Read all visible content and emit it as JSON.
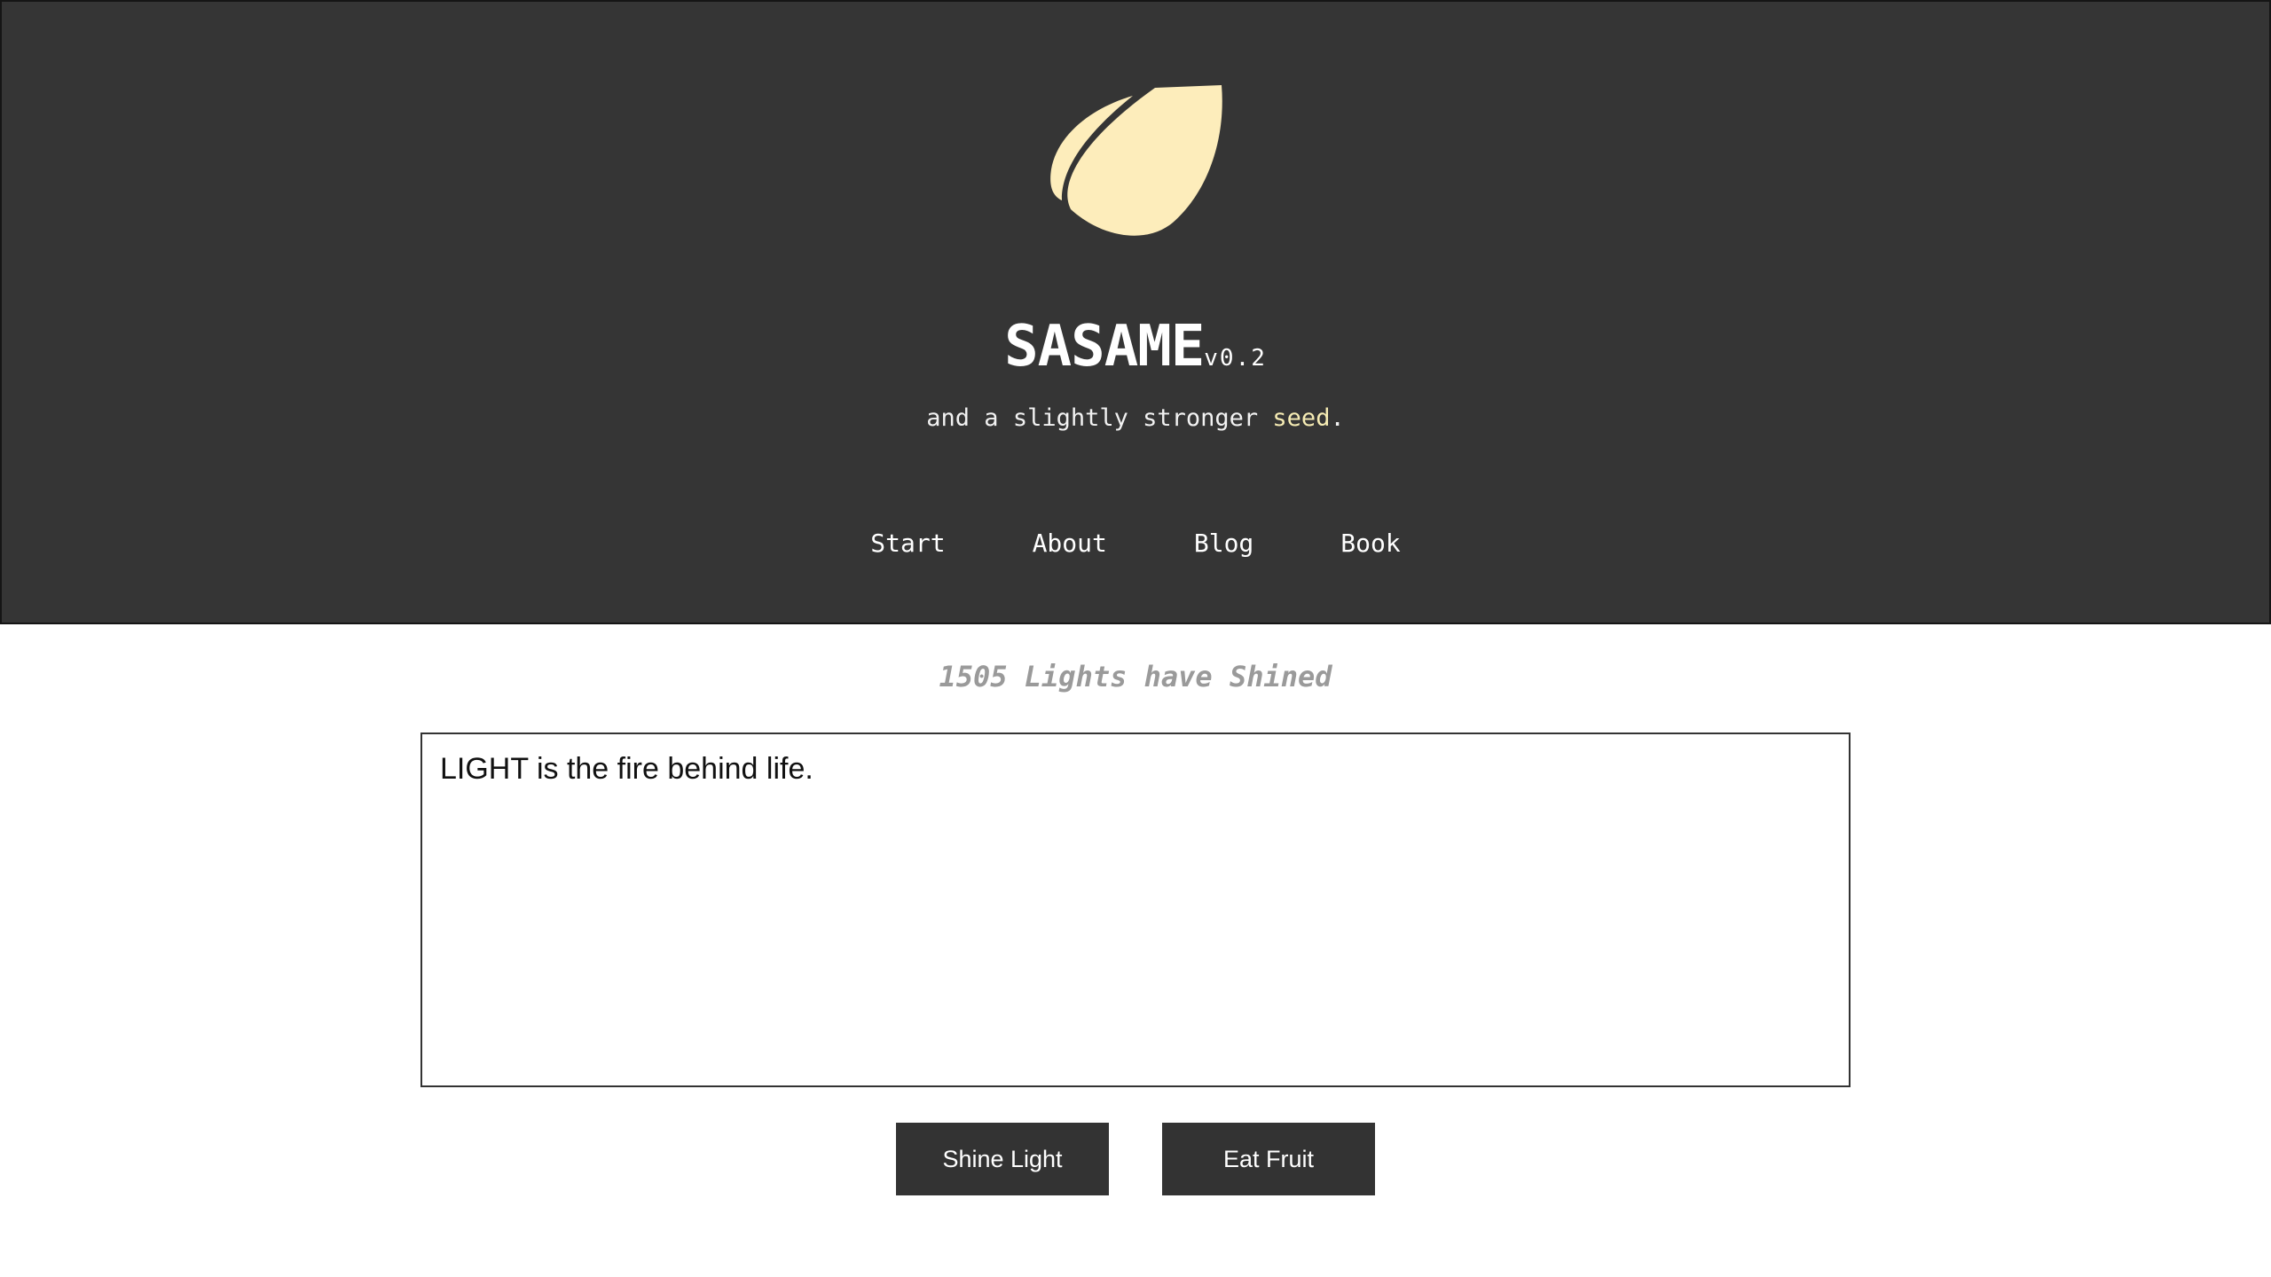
{
  "brand": {
    "title": "SASAME",
    "version": "v0.2",
    "tagline_prefix": "and a slightly stronger ",
    "tagline_highlight": "seed",
    "tagline_suffix": ".",
    "logo_icon": "seed-leaf-icon",
    "logo_color": "#fdedbb",
    "highlight_color": "#f6ecb4",
    "header_bg": "#353535"
  },
  "nav": {
    "items": [
      {
        "label": "Start"
      },
      {
        "label": "About"
      },
      {
        "label": "Blog"
      },
      {
        "label": "Book"
      }
    ]
  },
  "main": {
    "counter_text": "1505 Lights have Shined",
    "textarea_value": "LIGHT is the fire behind life.",
    "shine_label": "Shine Light",
    "eat_label": "Eat Fruit",
    "button_bg": "#333333"
  }
}
